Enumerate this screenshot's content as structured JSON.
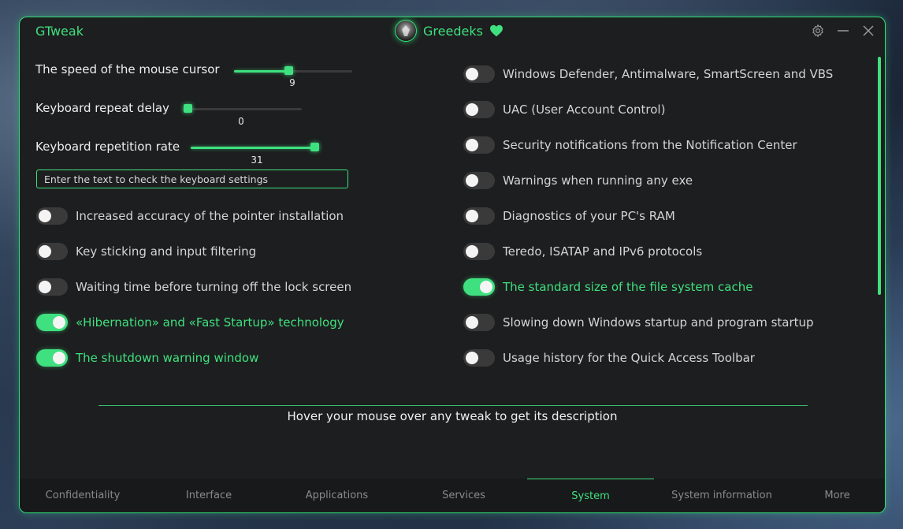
{
  "app": {
    "title": "GTweak",
    "user": "Greedeks"
  },
  "sliders": [
    {
      "label": "The speed of the mouse cursor",
      "value": "9",
      "fraction": 0.46
    },
    {
      "label": "Keyboard repeat delay",
      "value": "0",
      "fraction": 0.0
    },
    {
      "label": "Keyboard repetition rate",
      "value": "31",
      "fraction": 1.0
    }
  ],
  "keyboard_input": {
    "placeholder": "Enter the text to check the keyboard settings"
  },
  "left_toggles": [
    {
      "label": "Increased accuracy of the pointer installation",
      "on": false
    },
    {
      "label": "Key sticking and input filtering",
      "on": false
    },
    {
      "label": "Waiting time before turning off the lock screen",
      "on": false
    },
    {
      "label": "«Hibernation» and «Fast Startup» technology",
      "on": true
    },
    {
      "label": "The shutdown warning window",
      "on": true
    }
  ],
  "right_toggles": [
    {
      "label": "Windows Defender, Antimalware, SmartScreen and VBS",
      "on": false
    },
    {
      "label": "UAC (User Account Control)",
      "on": false
    },
    {
      "label": "Security notifications from the Notification Center",
      "on": false
    },
    {
      "label": "Warnings when running any exe",
      "on": false
    },
    {
      "label": "Diagnostics of your PC's RAM",
      "on": false
    },
    {
      "label": "Teredo, ISATAP and IPv6 protocols",
      "on": false
    },
    {
      "label": "The standard size of the file system cache",
      "on": true
    },
    {
      "label": "Slowing down Windows startup and program startup",
      "on": false
    },
    {
      "label": "Usage history for the Quick Access Toolbar",
      "on": false
    }
  ],
  "description": "Hover your mouse over any tweak to get its description",
  "tabs": [
    {
      "label": "Confidentiality",
      "active": false
    },
    {
      "label": "Interface",
      "active": false
    },
    {
      "label": "Applications",
      "active": false
    },
    {
      "label": "Services",
      "active": false
    },
    {
      "label": "System",
      "active": true
    },
    {
      "label": "System information",
      "active": false
    },
    {
      "label": "More",
      "active": false
    }
  ],
  "colors": {
    "accent": "#3fe07f",
    "background": "#1d1e1f"
  },
  "icons": {
    "settings": "gear-icon",
    "minimize": "minimize-icon",
    "close": "close-icon",
    "heart": "heart-icon"
  }
}
